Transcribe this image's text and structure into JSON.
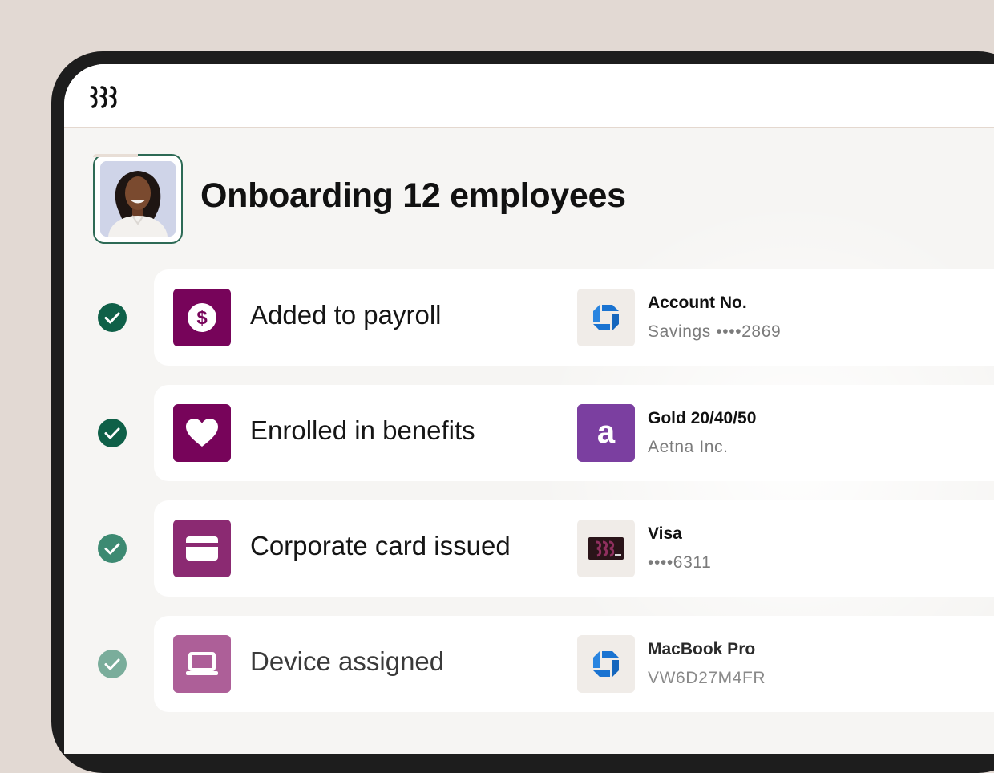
{
  "header": {
    "logo": "rippling-logo-icon"
  },
  "page": {
    "title": "Onboarding 12 employees"
  },
  "colors": {
    "check_1": "#0f6048",
    "check_2": "#0f6048",
    "check_3": "#3d8a72",
    "check_4": "#7aad9b",
    "tile_1": "#77045a",
    "tile_2": "#77045a",
    "tile_3": "#8b2a72",
    "tile_4": "#ad5f98"
  },
  "tasks": [
    {
      "label": "Added to payroll",
      "icon": "dollar-icon",
      "provider_icon": "chase-logo-icon",
      "detail_title": "Account No.",
      "detail_sub": "Savings ••••2869"
    },
    {
      "label": "Enrolled in benefits",
      "icon": "heart-icon",
      "provider_icon": "aetna-logo-icon",
      "detail_title": "Gold 20/40/50",
      "detail_sub": "Aetna Inc."
    },
    {
      "label": "Corporate card issued",
      "icon": "credit-card-icon",
      "provider_icon": "visa-card-image",
      "detail_title": "Visa",
      "detail_sub": "••••6311"
    },
    {
      "label": "Device assigned",
      "icon": "laptop-icon",
      "provider_icon": "chase-logo-icon",
      "detail_title": "MacBook Pro",
      "detail_sub": "VW6D27M4FR"
    }
  ]
}
